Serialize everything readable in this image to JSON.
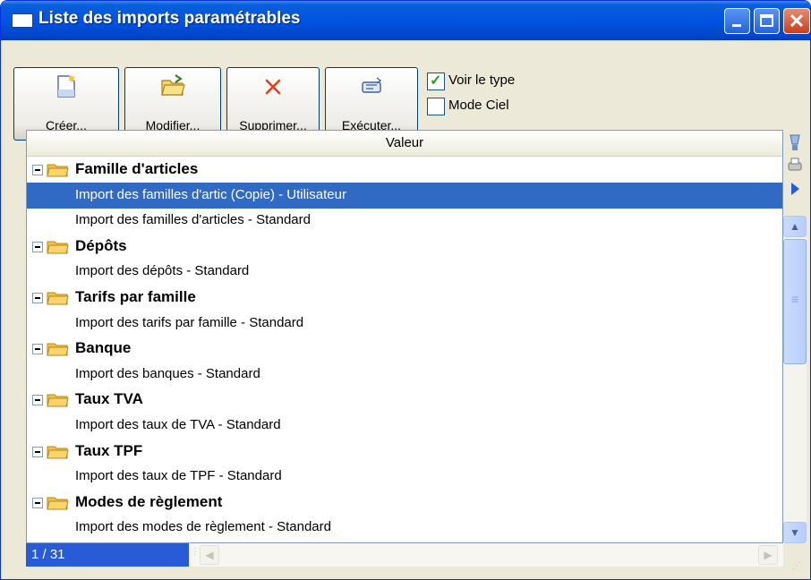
{
  "window": {
    "title": "Liste des imports paramétrables"
  },
  "toolbar": {
    "buttons": [
      {
        "label": "Créer...",
        "icon": "new-document-icon"
      },
      {
        "label": "Modifier...",
        "icon": "open-folder-icon"
      },
      {
        "label": "Supprimer...",
        "icon": "delete-x-icon"
      },
      {
        "label": "Exécuter...",
        "icon": "run-icon"
      }
    ],
    "checkboxes": [
      {
        "label": "Voir le type",
        "checked": true
      },
      {
        "label": "Mode Ciel",
        "checked": false
      }
    ]
  },
  "grid": {
    "column_header": "Valeur",
    "rows": [
      {
        "type": "group",
        "label": "Famille d'articles"
      },
      {
        "type": "item",
        "label": "Import des familles d'artic (Copie) - Utilisateur",
        "selected": true
      },
      {
        "type": "item",
        "label": "Import des familles d'articles - Standard"
      },
      {
        "type": "group",
        "label": "Dépôts"
      },
      {
        "type": "item",
        "label": "Import des dépôts - Standard"
      },
      {
        "type": "group",
        "label": "Tarifs par famille"
      },
      {
        "type": "item",
        "label": "Import des tarifs par famille - Standard"
      },
      {
        "type": "group",
        "label": "Banque"
      },
      {
        "type": "item",
        "label": "Import des banques - Standard"
      },
      {
        "type": "group",
        "label": "Taux TVA"
      },
      {
        "type": "item",
        "label": "Import des taux de TVA - Standard"
      },
      {
        "type": "group",
        "label": "Taux TPF"
      },
      {
        "type": "item",
        "label": "Import des taux de TPF - Standard"
      },
      {
        "type": "group",
        "label": "Modes de règlement"
      },
      {
        "type": "item",
        "label": "Import des modes de règlement - Standard"
      }
    ]
  },
  "status": {
    "position": "1 / 31"
  },
  "colors": {
    "titlebar": "#0054e3",
    "selection": "#316ac5",
    "folder": "#f5c242"
  }
}
